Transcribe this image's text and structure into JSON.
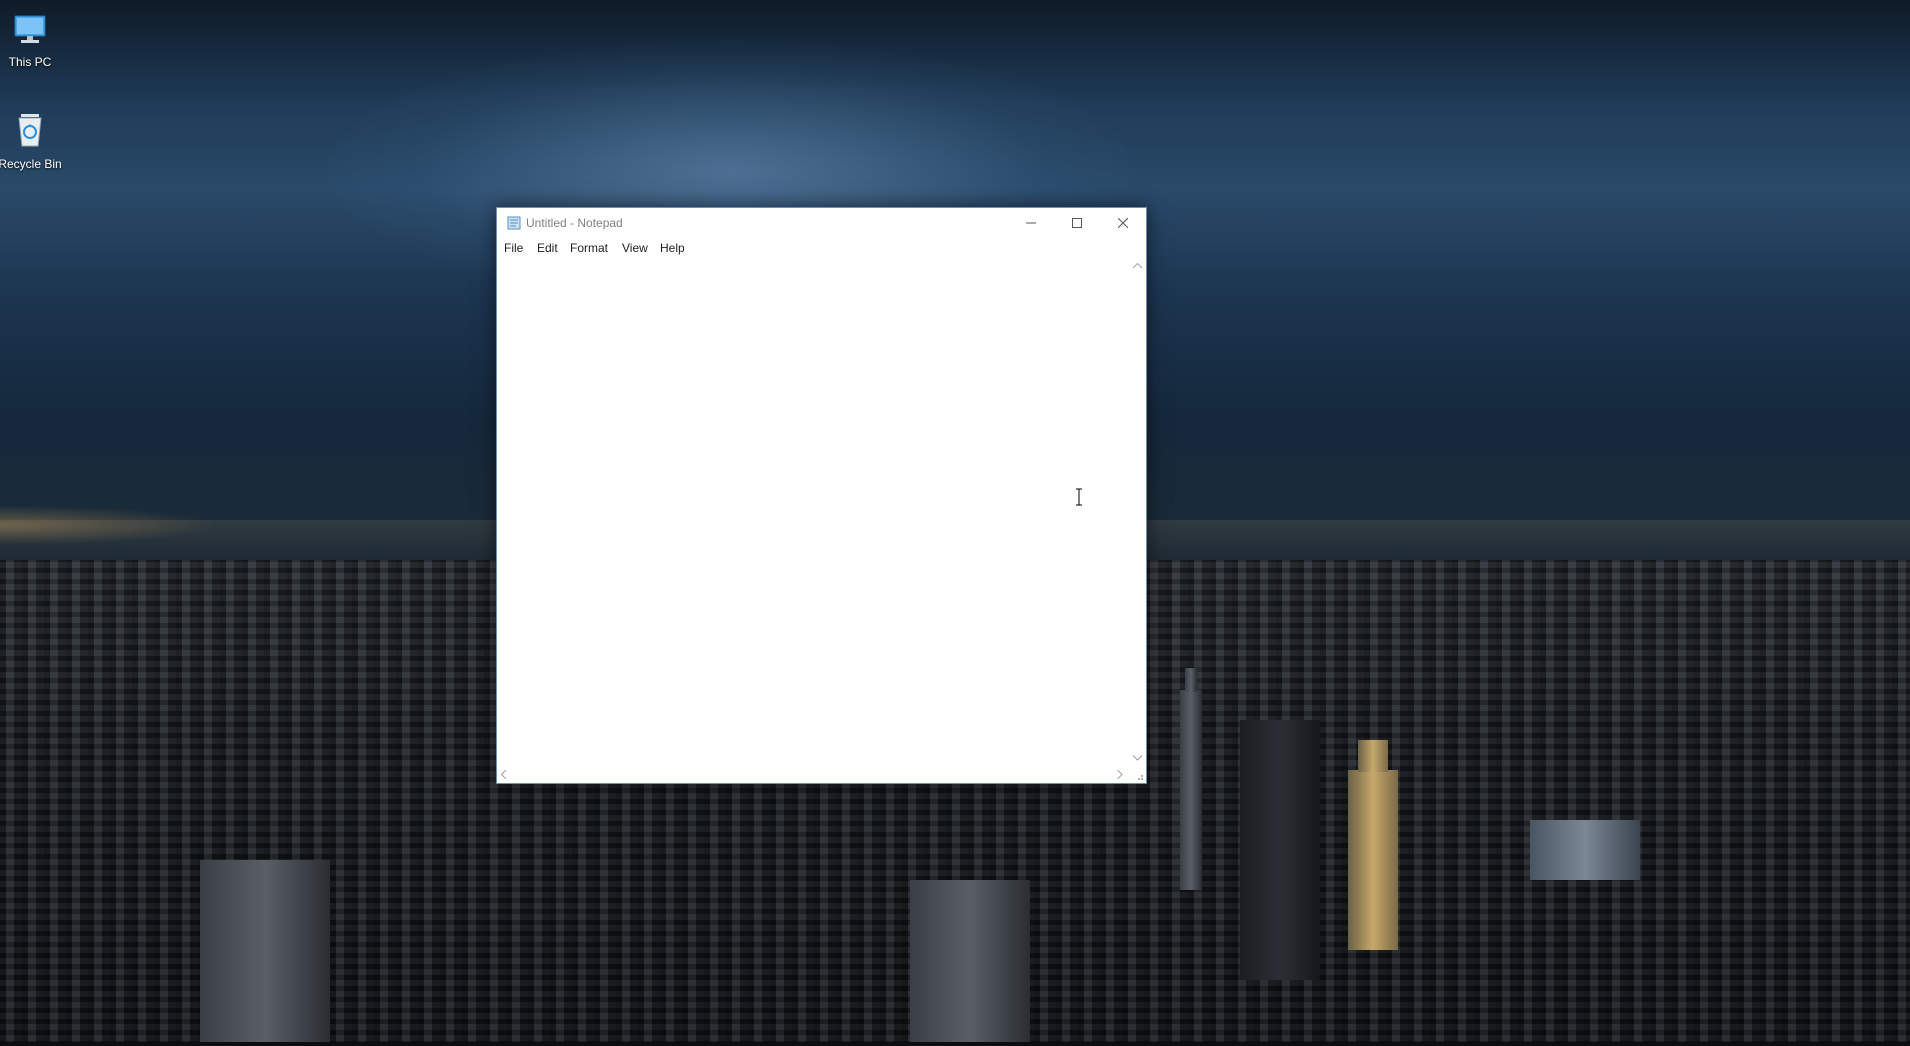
{
  "desktop": {
    "icons": [
      {
        "label": "This PC",
        "icon": "computer-icon"
      },
      {
        "label": "Recycle Bin",
        "icon": "recycle-bin-icon"
      }
    ]
  },
  "notepad": {
    "title": "Untitled - Notepad",
    "menu": [
      "File",
      "Edit",
      "Format",
      "View",
      "Help"
    ],
    "content": "",
    "controls": {
      "minimize": "minimize-icon",
      "maximize": "maximize-icon",
      "close": "close-icon"
    }
  }
}
